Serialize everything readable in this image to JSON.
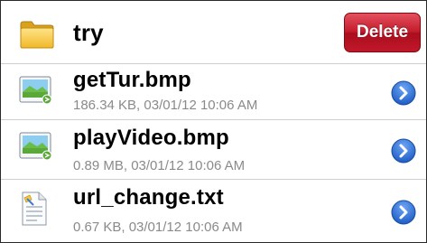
{
  "folder": {
    "name": "try",
    "delete_label": "Delete"
  },
  "files": [
    {
      "name": "getTur.bmp",
      "details": "186.34 KB, 03/01/12 10:06 AM",
      "icon": "image-file-icon"
    },
    {
      "name": "playVideo.bmp",
      "details": "0.89 MB, 03/01/12 10:06 AM",
      "icon": "image-file-icon"
    },
    {
      "name": "url_change.txt",
      "details": "0.67 KB, 03/01/12 10:06 AM",
      "icon": "text-file-icon"
    }
  ],
  "colors": {
    "delete": "#c31b2b",
    "disclosure": "#2f6fd6",
    "subtext": "#8a8a8a"
  }
}
